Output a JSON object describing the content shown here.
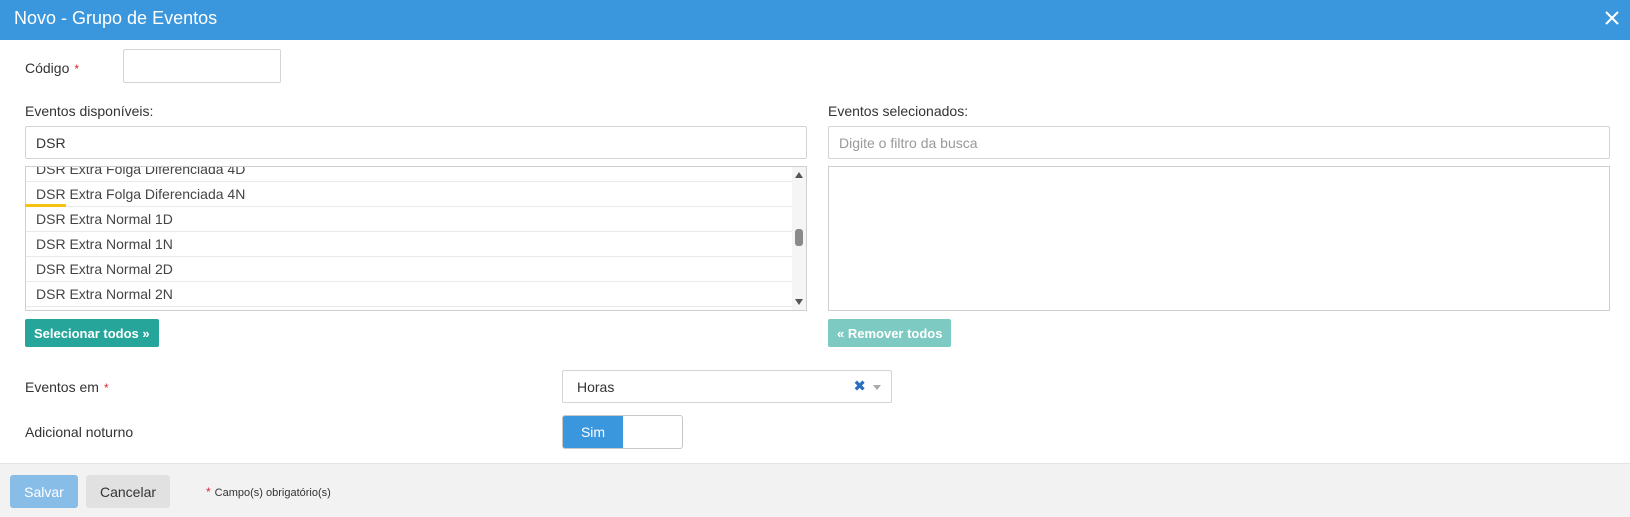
{
  "dialog": {
    "title": "Novo - Grupo de Eventos"
  },
  "form": {
    "codigo": {
      "label": "Código",
      "required_mark": "*",
      "value": ""
    },
    "available": {
      "label": "Eventos disponíveis:",
      "filter_value": "DSR",
      "items": [
        "DSR Extra Folga Diferenciada 4D",
        "DSR Extra Folga Diferenciada 4N",
        "DSR Extra Normal 1D",
        "DSR Extra Normal 1N",
        "DSR Extra Normal 2D",
        "DSR Extra Normal 2N"
      ],
      "select_all_label": "Selecionar todos »"
    },
    "selected": {
      "label": "Eventos selecionados:",
      "filter_placeholder": "Digite o filtro da busca",
      "remove_all_label": "« Remover todos"
    },
    "eventos_em": {
      "label": "Eventos em",
      "required_mark": "*",
      "value": "Horas"
    },
    "adicional_noturno": {
      "label": "Adicional noturno",
      "toggle_on_label": "Sim"
    }
  },
  "footer": {
    "save_label": "Salvar",
    "cancel_label": "Cancelar",
    "required_mark": "*",
    "required_note": "Campo(s) obrigatório(s)"
  },
  "colors": {
    "primary": "#3a97dd",
    "teal_button": "#26a69a",
    "teal_button_disabled": "#7dcac2",
    "required": "#d9262c",
    "highlight": "#f5c20f"
  },
  "icons": {
    "close": "close-icon",
    "clear": "clear-x-icon",
    "caret": "chevron-down-icon"
  }
}
